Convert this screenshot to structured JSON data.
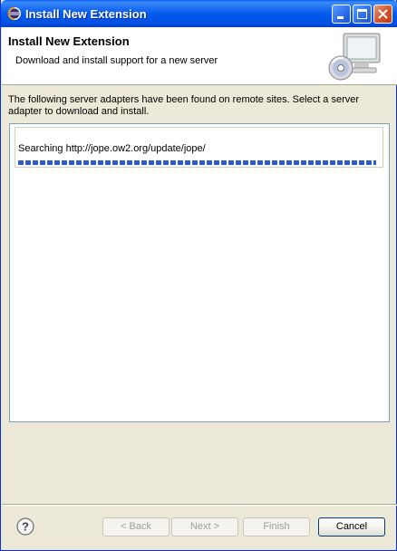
{
  "window": {
    "title": "Install New Extension"
  },
  "header": {
    "title": "Install New Extension",
    "description": "Download and install support for a new server"
  },
  "main": {
    "instructions": "The following server adapters have been found on remote sites. Select a server adapter to download and install.",
    "progress": {
      "label": "Searching http://jope.ow2.org/update/jope/",
      "value_fraction": 1.0,
      "color": "#2f5cc0"
    }
  },
  "buttons": {
    "back": "< Back",
    "next": "Next >",
    "finish": "Finish",
    "cancel": "Cancel"
  },
  "colors": {
    "titlebar": "#0058ee",
    "accent": "#003c74"
  }
}
